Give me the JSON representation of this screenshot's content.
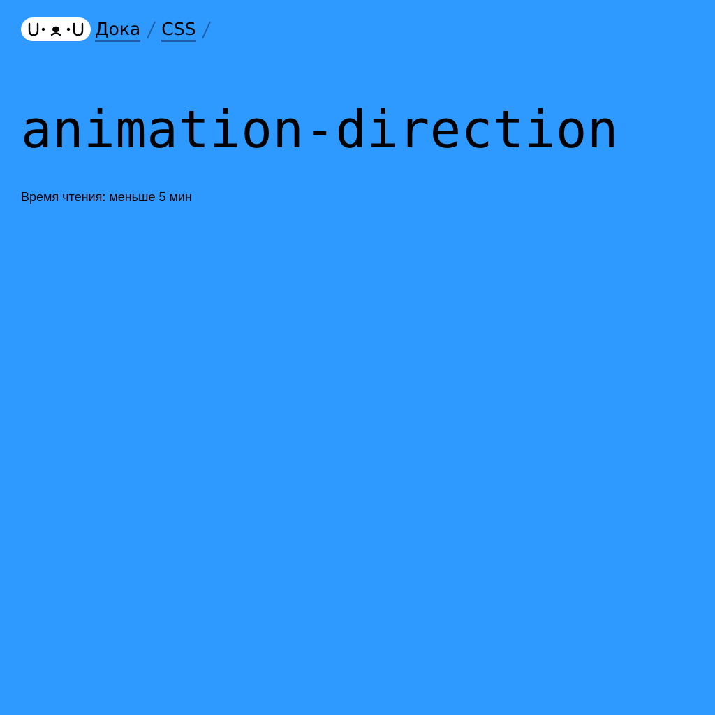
{
  "header": {
    "logo_text": "U•ᴥ•U",
    "breadcrumbs": [
      {
        "label": "Дока"
      },
      {
        "label": "CSS"
      }
    ]
  },
  "article": {
    "title": "animation-direction",
    "reading_time": "Время чтения: меньше 5 мин"
  },
  "colors": {
    "background": "#2e99ff",
    "text": "#000000",
    "link_underline": "#1c5fa8",
    "logo_background": "#ffffff"
  }
}
